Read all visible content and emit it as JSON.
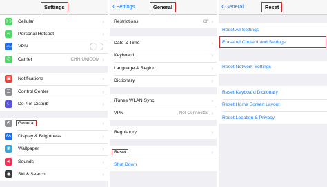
{
  "settings": {
    "title": "Settings",
    "rows_group1": [
      {
        "label": "Cellular",
        "icon": "cellular-icon",
        "glyph": "((·))",
        "color": "#4cd964"
      },
      {
        "label": "Personal Hotspot",
        "icon": "hotspot-icon",
        "glyph": "∞",
        "color": "#4cd964"
      },
      {
        "label": "VPN",
        "icon": "vpn-icon",
        "glyph": "VPN",
        "color": "#1e6fe8"
      },
      {
        "label": "Carrier",
        "icon": "phone-icon",
        "glyph": "✆",
        "color": "#4cd964",
        "value": "CHN-UNICOM"
      }
    ],
    "rows_group2": [
      {
        "label": "Notifications",
        "icon": "notifications-icon",
        "glyph": "▣",
        "color": "#ff3b30"
      },
      {
        "label": "Control Center",
        "icon": "control-center-icon",
        "glyph": "☰",
        "color": "#8e8e93"
      },
      {
        "label": "Do Not Disturb",
        "icon": "moon-icon",
        "glyph": "☾",
        "color": "#5856d6"
      }
    ],
    "rows_group3": [
      {
        "label": "General",
        "icon": "gear-icon",
        "glyph": "⚙",
        "color": "#8e8e93"
      },
      {
        "label": "Display & Brightness",
        "icon": "brightness-icon",
        "glyph": "AA",
        "color": "#1e6fe8"
      },
      {
        "label": "Wallpaper",
        "icon": "wallpaper-icon",
        "glyph": "❀",
        "color": "#34aadc"
      },
      {
        "label": "Sounds",
        "icon": "sounds-icon",
        "glyph": "◀)",
        "color": "#ff2d55"
      },
      {
        "label": "Siri & Search",
        "icon": "siri-icon",
        "glyph": "◉",
        "color": "#3a3a3c"
      }
    ]
  },
  "general": {
    "back_label": "Settings",
    "title": "General",
    "rows": {
      "restrictions": {
        "label": "Restrictions",
        "value": "Off"
      },
      "date_time": "Date & Time",
      "keyboard": "Keyboard",
      "language_region": "Language & Region",
      "dictionary": "Dictionary",
      "itunes_wlan_sync": "iTunes WLAN Sync",
      "vpn": {
        "label": "VPN",
        "value": "Not Connected"
      },
      "regulatory": "Regulatory",
      "reset": "Reset",
      "shut_down": "Shut Down"
    }
  },
  "reset": {
    "back_label": "General",
    "title": "Reset",
    "rows": {
      "reset_all_settings": "Reset All Settings",
      "erase_all": "Erase All Content and Settings",
      "reset_network": "Reset Network Settings",
      "reset_keyboard_dictionary": "Reset Keyboard Dictionary",
      "reset_home_screen": "Reset Home Screen Layout",
      "reset_location_privacy": "Reset Location & Privacy"
    }
  },
  "colors": {
    "accent": "#1a7cf2",
    "highlight_box": "#d3242a"
  }
}
